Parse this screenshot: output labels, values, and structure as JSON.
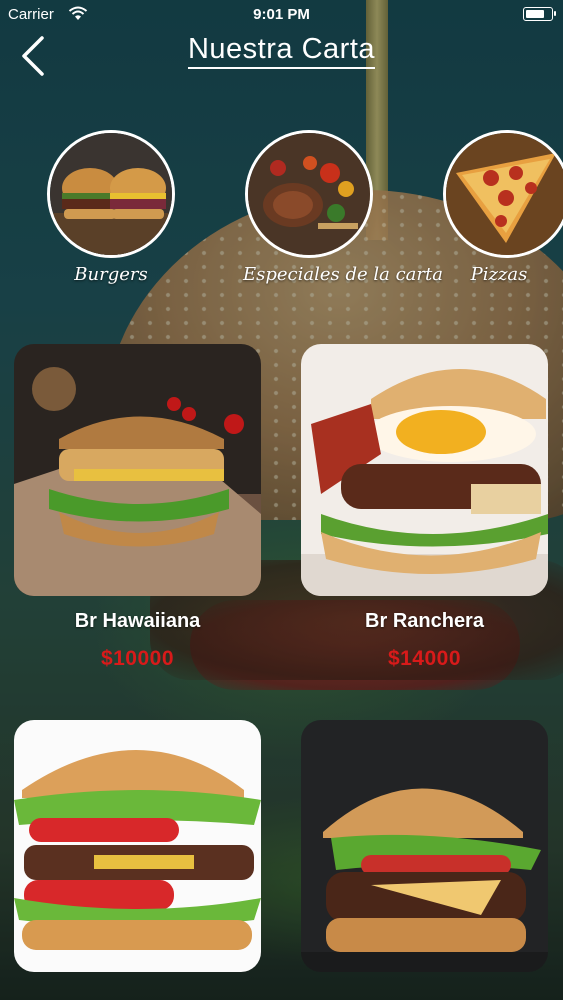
{
  "status_bar": {
    "carrier": "Carrier",
    "time": "9:01 PM",
    "battery_level": 0.75
  },
  "header": {
    "title": "Nuestra Carta",
    "back_icon": "chevron-left-icon"
  },
  "categories": [
    {
      "label": "Burgers"
    },
    {
      "label": "Especiales de la carta"
    },
    {
      "label": "Pizzas"
    }
  ],
  "products": [
    {
      "name": "Br Hawaiiana",
      "price": "$10000"
    },
    {
      "name": "Br Ranchera",
      "price": "$14000"
    }
  ],
  "colors": {
    "price": "#d81a1a",
    "text": "#ffffff"
  }
}
